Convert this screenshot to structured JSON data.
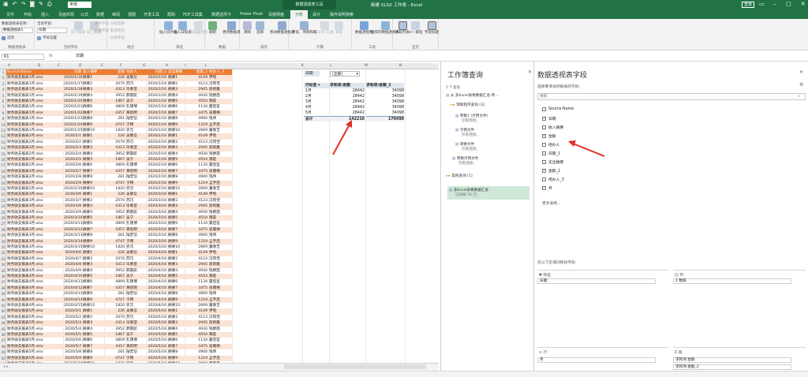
{
  "titlebar": {
    "font_name": "宋体",
    "context_tool": "数据透视表工具",
    "window_title": "新建 XLSX 工作表 - Excel",
    "login": "登录"
  },
  "tabs": [
    "文件",
    "开始",
    "插入",
    "页面布局",
    "公式",
    "数据",
    "审阅",
    "视图",
    "开发工具",
    "帮助",
    "PDF工具集",
    "数据选项卡",
    "Power Pivot",
    "百度网盘",
    "分析",
    "设计",
    "操作说明搜索"
  ],
  "ribbon": {
    "pivot_name_label": "数据透视表名称:",
    "pivot_name_value": "数据透视表1",
    "options": "选项",
    "group_pivot": "数据透视表",
    "active_field_label": "活动字段:",
    "active_field_value": "日期",
    "field_settings": "字段设置",
    "drill_down": "向下钻取",
    "drill_up": "向上钻取",
    "expand": "展开字段",
    "collapse": "折叠字段",
    "group_active": "活动字段",
    "group_sel": "分组选择",
    "ungroup": "取消组合",
    "group_field": "分组字段",
    "group_combine": "组合",
    "slicer": "插入切片器",
    "timeline": "插入日程表",
    "filter_conn": "筛选器连接",
    "group_filter": "筛选",
    "refresh": "刷新",
    "change_source": "更改数据源",
    "group_data": "数据",
    "clear": "清除",
    "select": "选择",
    "move": "移动数据透视表",
    "group_actions": "操作",
    "fields_items": "字段、项目和集",
    "olap": "OLAP 工具",
    "relations": "关系",
    "group_calc": "计算",
    "pivot_chart": "数据透视图",
    "recommended": "推荐的数据透视表",
    "group_tools": "工具",
    "field_list": "字段列表",
    "plus_minus": "+/- 按钮",
    "field_headers": "字段标题",
    "group_show": "显示"
  },
  "formula": {
    "cell": "K1",
    "fx": "fx",
    "value": "日期"
  },
  "columns": [
    "A",
    "B",
    "C",
    "D",
    "E",
    "F",
    "G",
    "H",
    "I",
    "J",
    "K",
    "L",
    "M",
    "N"
  ],
  "sheet": {
    "headers": [
      "Source.Name",
      "日期",
      "收入摘要",
      "金额",
      "经办人",
      "日期_1",
      "支出摘要",
      "金额_2",
      "经办人_3"
    ],
    "rows": [
      [
        "财务收支报表1月.xlsx",
        "2020/1/16",
        "摘要1",
        "226",
        "吴敬信",
        "2020/1/16",
        "摘要1",
        "4149",
        "伊昭"
      ],
      [
        "财务收支报表1月.xlsx",
        "2020/1/17",
        "摘要2",
        "2070",
        "苏巧",
        "2020/1/16",
        "摘要2",
        "4123",
        "冯瑶佳"
      ],
      [
        "财务收支报表1月.xlsx",
        "2020/1/18",
        "摘要3",
        "4313",
        "毕春苗",
        "2020/1/16",
        "摘要3",
        "2945",
        "薛莉雅"
      ],
      [
        "财务收支报表1月.xlsx",
        "2020/1/19",
        "摘要4",
        "3952",
        "郝雷航",
        "2020/1/16",
        "摘要4",
        "4930",
        "钱爵茜"
      ],
      [
        "财务收支报表1月.xlsx",
        "2020/1/20",
        "摘要5",
        "1867",
        "吴宁",
        "2020/1/16",
        "摘要5",
        "4554",
        "酆莊"
      ],
      [
        "财务收支报表1月.xlsx",
        "2020/1/21",
        "摘要6",
        "4809",
        "孔瑾博",
        "2020/1/16",
        "摘要6",
        "1134",
        "霍启哲"
      ],
      [
        "财务收支报表1月.xlsx",
        "2020/1/22",
        "摘要7",
        "4357",
        "黄航明",
        "2020/1/16",
        "摘要7",
        "3475",
        "皮雁梅"
      ],
      [
        "财务收支报表1月.xlsx",
        "2020/1/23",
        "摘要8",
        "281",
        "陆宏恺",
        "2020/1/16",
        "摘要8",
        "4900",
        "钱炜"
      ],
      [
        "财务收支报表1月.xlsx",
        "2020/1/24",
        "摘要9",
        "4747",
        "于畅",
        "2020/1/16",
        "摘要9",
        "1219",
        "孟宇启"
      ],
      [
        "财务收支报表1月.xlsx",
        "2020/1/25",
        "摘要10",
        "1820",
        "农元",
        "2020/1/16",
        "摘要10",
        "2669",
        "董春吉"
      ],
      [
        "财务收支报表2月.xlsx",
        "2020/2/1",
        "摘要1",
        "226",
        "吴敬信",
        "2020/2/16",
        "摘要1",
        "4149",
        "伊昭"
      ],
      [
        "财务收支报表2月.xlsx",
        "2020/2/2",
        "摘要2",
        "2070",
        "苏巧",
        "2020/2/16",
        "摘要2",
        "4123",
        "冯瑶佳"
      ],
      [
        "财务收支报表2月.xlsx",
        "2020/2/3",
        "摘要3",
        "4313",
        "毕春苗",
        "2020/2/16",
        "摘要3",
        "2945",
        "薛莉雅"
      ],
      [
        "财务收支报表2月.xlsx",
        "2020/2/4",
        "摘要4",
        "3952",
        "郝雷航",
        "2020/2/16",
        "摘要4",
        "4930",
        "钱爵茜"
      ],
      [
        "财务收支报表2月.xlsx",
        "2020/2/5",
        "摘要5",
        "1867",
        "吴宁",
        "2020/2/16",
        "摘要5",
        "4554",
        "酆莊"
      ],
      [
        "财务收支报表2月.xlsx",
        "2020/2/6",
        "摘要6",
        "4809",
        "孔瑾博",
        "2020/2/16",
        "摘要6",
        "1134",
        "霍启哲"
      ],
      [
        "财务收支报表2月.xlsx",
        "2020/2/7",
        "摘要7",
        "4357",
        "黄航明",
        "2020/2/16",
        "摘要7",
        "3475",
        "皮雁梅"
      ],
      [
        "财务收支报表2月.xlsx",
        "2020/2/8",
        "摘要8",
        "281",
        "陆宏恺",
        "2020/2/16",
        "摘要8",
        "4900",
        "钱炜"
      ],
      [
        "财务收支报表2月.xlsx",
        "2020/2/9",
        "摘要9",
        "4747",
        "于畅",
        "2020/2/16",
        "摘要9",
        "1219",
        "孟宇启"
      ],
      [
        "财务收支报表2月.xlsx",
        "2020/2/10",
        "摘要10",
        "1820",
        "农元",
        "2020/2/16",
        "摘要10",
        "2669",
        "董春吉"
      ],
      [
        "财务收支报表3月.xlsx",
        "2020/3/6",
        "摘要1",
        "226",
        "吴敬信",
        "2020/3/16",
        "摘要1",
        "4149",
        "伊昭"
      ],
      [
        "财务收支报表3月.xlsx",
        "2020/3/7",
        "摘要2",
        "2070",
        "苏巧",
        "2020/3/16",
        "摘要2",
        "4123",
        "冯瑶佳"
      ],
      [
        "财务收支报表3月.xlsx",
        "2020/3/8",
        "摘要3",
        "4313",
        "毕春苗",
        "2020/3/16",
        "摘要3",
        "2945",
        "薛莉雅"
      ],
      [
        "财务收支报表3月.xlsx",
        "2020/3/9",
        "摘要4",
        "3952",
        "郝雷航",
        "2020/3/16",
        "摘要4",
        "4930",
        "钱爵茜"
      ],
      [
        "财务收支报表3月.xlsx",
        "2020/3/10",
        "摘要5",
        "1867",
        "吴宁",
        "2020/3/16",
        "摘要5",
        "4554",
        "酆莊"
      ],
      [
        "财务收支报表3月.xlsx",
        "2020/3/11",
        "摘要6",
        "4809",
        "孔瑾博",
        "2020/3/16",
        "摘要6",
        "1134",
        "霍启哲"
      ],
      [
        "财务收支报表3月.xlsx",
        "2020/3/12",
        "摘要7",
        "4357",
        "黄航明",
        "2020/3/16",
        "摘要7",
        "3475",
        "皮雁梅"
      ],
      [
        "财务收支报表3月.xlsx",
        "2020/3/13",
        "摘要8",
        "281",
        "陆宏恺",
        "2020/3/16",
        "摘要8",
        "4900",
        "钱炜"
      ],
      [
        "财务收支报表3月.xlsx",
        "2020/3/14",
        "摘要9",
        "4747",
        "于畅",
        "2020/3/16",
        "摘要9",
        "1219",
        "孟宇启"
      ],
      [
        "财务收支报表3月.xlsx",
        "2020/3/15",
        "摘要10",
        "1820",
        "农元",
        "2020/3/16",
        "摘要10",
        "2669",
        "董春吉"
      ],
      [
        "财务收支报表4月.xlsx",
        "2020/4/6",
        "摘要1",
        "226",
        "吴敬信",
        "2020/4/16",
        "摘要1",
        "4149",
        "伊昭"
      ],
      [
        "财务收支报表4月.xlsx",
        "2020/4/7",
        "摘要2",
        "2070",
        "苏巧",
        "2020/4/16",
        "摘要2",
        "4123",
        "冯瑶佳"
      ],
      [
        "财务收支报表4月.xlsx",
        "2020/4/8",
        "摘要3",
        "4313",
        "毕春苗",
        "2020/4/16",
        "摘要3",
        "2945",
        "薛莉雅"
      ],
      [
        "财务收支报表4月.xlsx",
        "2020/4/9",
        "摘要4",
        "3952",
        "郝雷航",
        "2020/4/16",
        "摘要4",
        "4930",
        "钱爵茜"
      ],
      [
        "财务收支报表4月.xlsx",
        "2020/4/10",
        "摘要5",
        "1867",
        "吴宁",
        "2020/4/16",
        "摘要5",
        "4554",
        "酆莊"
      ],
      [
        "财务收支报表4月.xlsx",
        "2020/4/11",
        "摘要6",
        "4809",
        "孔瑾博",
        "2020/4/16",
        "摘要6",
        "1134",
        "霍启哲"
      ],
      [
        "财务收支报表4月.xlsx",
        "2020/4/12",
        "摘要7",
        "4357",
        "黄航明",
        "2020/4/16",
        "摘要7",
        "3475",
        "皮雁梅"
      ],
      [
        "财务收支报表4月.xlsx",
        "2020/4/13",
        "摘要8",
        "281",
        "陆宏恺",
        "2020/4/16",
        "摘要8",
        "4900",
        "钱炜"
      ],
      [
        "财务收支报表4月.xlsx",
        "2020/4/14",
        "摘要9",
        "4747",
        "于畅",
        "2020/4/16",
        "摘要9",
        "1219",
        "孟宇启"
      ],
      [
        "财务收支报表4月.xlsx",
        "2020/4/15",
        "摘要10",
        "1820",
        "农元",
        "2020/4/16",
        "摘要10",
        "2669",
        "董春吉"
      ],
      [
        "财务收支报表5月.xlsx",
        "2020/5/1",
        "摘要1",
        "226",
        "吴敬信",
        "2020/5/16",
        "摘要1",
        "4149",
        "伊昭"
      ],
      [
        "财务收支报表5月.xlsx",
        "2020/5/2",
        "摘要2",
        "2070",
        "苏巧",
        "2020/5/16",
        "摘要2",
        "4123",
        "冯瑶佳"
      ],
      [
        "财务收支报表5月.xlsx",
        "2020/5/3",
        "摘要3",
        "4313",
        "毕春苗",
        "2020/5/16",
        "摘要3",
        "2945",
        "薛莉雅"
      ],
      [
        "财务收支报表5月.xlsx",
        "2020/5/4",
        "摘要4",
        "3952",
        "郝雷航",
        "2020/5/16",
        "摘要4",
        "4930",
        "钱爵茜"
      ],
      [
        "财务收支报表5月.xlsx",
        "2020/5/5",
        "摘要5",
        "1867",
        "吴宁",
        "2020/5/16",
        "摘要5",
        "4554",
        "酆莊"
      ],
      [
        "财务收支报表5月.xlsx",
        "2020/5/6",
        "摘要6",
        "4809",
        "孔瑾博",
        "2020/5/16",
        "摘要6",
        "1134",
        "霍启哲"
      ],
      [
        "财务收支报表5月.xlsx",
        "2020/5/7",
        "摘要7",
        "4357",
        "黄航明",
        "2020/5/16",
        "摘要7",
        "3475",
        "皮雁梅"
      ],
      [
        "财务收支报表5月.xlsx",
        "2020/5/8",
        "摘要8",
        "281",
        "陆宏恺",
        "2020/5/16",
        "摘要8",
        "4900",
        "钱炜"
      ],
      [
        "财务收支报表5月.xlsx",
        "2020/5/9",
        "摘要9",
        "4747",
        "于畅",
        "2020/5/16",
        "摘要9",
        "1219",
        "孟宇启"
      ],
      [
        "财务收支报表5月.xlsx",
        "2020/5/10",
        "摘要10",
        "1820",
        "农元",
        "2020/5/16",
        "摘要10",
        "2669",
        "董春吉"
      ]
    ]
  },
  "pivot": {
    "filter_field": "日期",
    "filter_value": "(全部)",
    "headers": [
      "行标签",
      "求和项:金额",
      "求和项:金额_2"
    ],
    "rows": [
      [
        "1月",
        "28442",
        "34098"
      ],
      [
        "2月",
        "28442",
        "34098"
      ],
      [
        "3月",
        "28442",
        "34098"
      ],
      [
        "4月",
        "28442",
        "34098"
      ],
      [
        "5月",
        "28442",
        "34098"
      ]
    ],
    "total": [
      "总计",
      "142210",
      "170490"
    ]
  },
  "query_pane": {
    "title": "工作簿查询",
    "count": "5 个查询",
    "items": [
      {
        "label": "从 多Excel表格数据汇总 转...",
        "sub": ""
      },
      {
        "label": "帮助程序查询 [3]",
        "sub": ""
      },
      {
        "label": "参数1 (示例文件)",
        "sub": "仅限连接。"
      },
      {
        "label": "示例文件",
        "sub": "仅限连接。"
      },
      {
        "label": "转换文件",
        "sub": "仅限连接。"
      },
      {
        "label": "转换示例文件",
        "sub": "仅限连接。"
      },
      {
        "label": "其他查询 [1]",
        "sub": ""
      },
      {
        "label": "多Excel表格数据汇总",
        "sub": "已加载 50 行。"
      }
    ]
  },
  "field_pane": {
    "title": "数据透视表字段",
    "subtitle": "选择要添加到报表的字段:",
    "search_placeholder": "搜索",
    "fields": [
      {
        "name": "Source.Name",
        "checked": false
      },
      {
        "name": "日期",
        "checked": true
      },
      {
        "name": "收入摘要",
        "checked": false
      },
      {
        "name": "金额",
        "checked": true
      },
      {
        "name": "经办人",
        "checked": false
      },
      {
        "name": "日期_1",
        "checked": false
      },
      {
        "name": "支出摘要",
        "checked": false
      },
      {
        "name": "金额_2",
        "checked": true
      },
      {
        "name": "经办人_3",
        "checked": false
      },
      {
        "name": "月",
        "checked": true
      }
    ],
    "more_tables": "更多表格...",
    "drag_hint": "在以下区域间拖动字段:",
    "filters_label": "筛选",
    "columns_label": "列",
    "rows_label": "行",
    "values_label": "值",
    "filter_items": [
      "日期"
    ],
    "column_items": [
      "Σ 数值"
    ],
    "row_items": [
      "月"
    ],
    "value_items": [
      "求和项:金额",
      "求和项:金额_2"
    ]
  },
  "colors": {
    "excel_green": "#217346",
    "header_orange": "#ed7d31",
    "band_orange": "#fbe4d6",
    "arrow_red": "#e0312a"
  }
}
